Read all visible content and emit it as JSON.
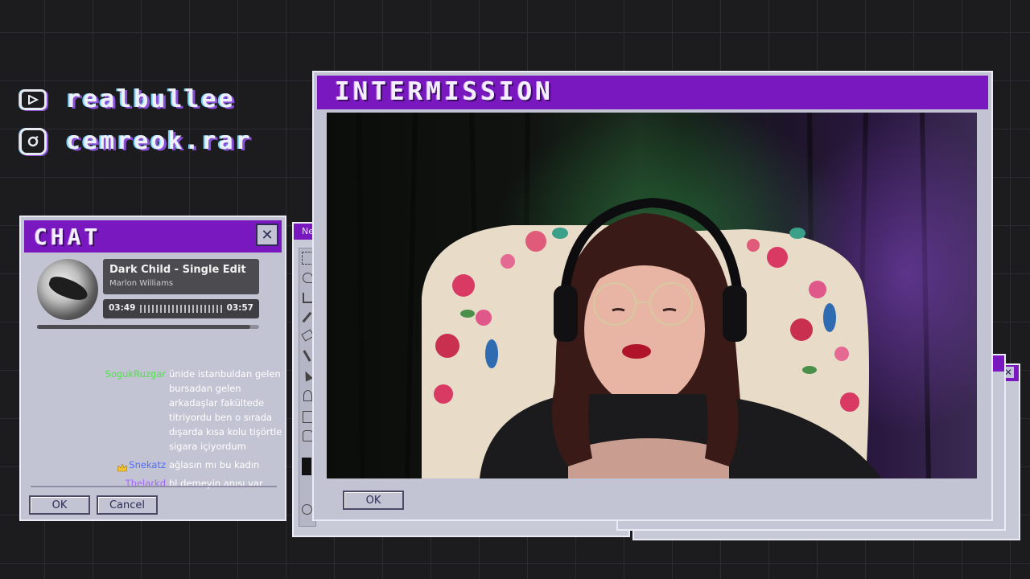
{
  "socials": [
    {
      "icon": "youtube-icon",
      "handle": "realbullee"
    },
    {
      "icon": "instagram-icon",
      "handle": "cemreok.rar"
    }
  ],
  "chat_window": {
    "title": "CHAT",
    "close_label": "✕",
    "ok_label": "OK",
    "cancel_label": "Cancel",
    "now_playing": {
      "song": "Dark Child - Single Edit",
      "artist": "Marlon Williams",
      "elapsed": "03:49",
      "total": "03:57",
      "progress": 0.96
    },
    "messages": [
      {
        "user": "SogukRuzgar",
        "color": "#52e04a",
        "badge": "",
        "text": "ünide istanbuldan gelen bursadan gelen arkadaşlar fakültede titriyordu ben o sırada dışarda kısa kolu tişörtle sigara içiyordum"
      },
      {
        "user": "Snekatz",
        "color": "#4f6cff",
        "badge": "crown-badge-icon",
        "text": "ağlasın mı bu kadın"
      },
      {
        "user": "Thelarkd",
        "color": "#a566ff",
        "badge": "",
        "text": "bl demeyin anısı var"
      }
    ]
  },
  "background_window": {
    "title": "Ne"
  },
  "main_window": {
    "title": "INTERMISSION",
    "ok_label": "OK"
  },
  "colors": {
    "accent_purple": "#7a18c0",
    "window_gray": "#c2c4d3"
  }
}
